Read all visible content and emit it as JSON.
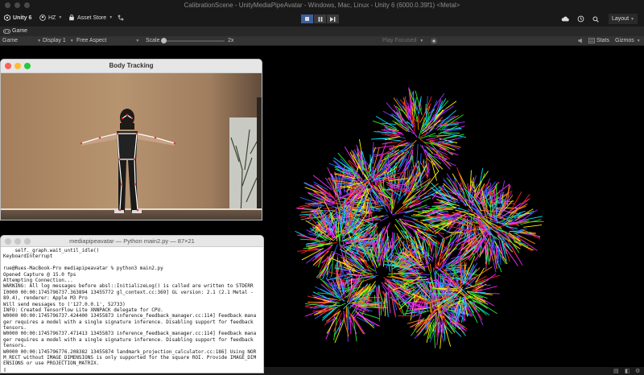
{
  "window": {
    "title": "CalibrationScene - UnityMediaPipeAvatar - Windows, Mac, Linux - Unity 6 (6000.0.39f1) <Metal>"
  },
  "toolbar": {
    "app_label": "Unity 6",
    "account_label": "HZ",
    "asset_store_label": "Asset Store",
    "layout_label": "Layout"
  },
  "tabs": {
    "game_label": "Game"
  },
  "game_controls": {
    "display_mode": "Game",
    "display": "Display 1",
    "aspect": "Free Aspect",
    "scale_label": "Scale",
    "scale_value": "2x",
    "play_focused": "Play Focused",
    "stats_label": "Stats",
    "gizmos_label": "Gizmos"
  },
  "body_tracking": {
    "title": "Body Tracking"
  },
  "terminal": {
    "title": "mediapipeavatar — Python main2.py — 87×21",
    "lines": [
      "    self._graph.wait_until_idle()",
      "KeyboardInterrupt",
      "",
      "rue@Rues-MacBook-Pro mediapipeavatar % python3 main2.py",
      "Opened Capture @ 15.0 fps",
      "Attempting Connection...",
      "WARNING: All log messages before absl::InitializeLog() is called are written to STDERR",
      "I0000 00:00:1745796737.363894 13455772 gl_context.cc:369] GL version: 2.1 (2.1 Metal -",
      "89.4), renderer: Apple M3 Pro",
      "Will send messages to ('127.0.0.1', 52733)",
      "INFO: Created TensorFlow Lite XNNPACK delegate for CPU.",
      "W0000 00:00:1745796737.424400 13455873 inference_feedback_manager.cc:114] Feedback mana",
      "ger requires a model with a single signature inference. Disabling support for feedback",
      "tensors.",
      "W0000 00:00:1745796737.471413 13455873 inference_feedback_manager.cc:114] Feedback mana",
      "ger requires a model with a single signature inference. Disabling support for feedback",
      "tensors.",
      "W0000 00:00:1745796776.208382 13455874 landmark_projection_calculator.cc:186] Using NOR",
      "M_RECT without IMAGE_DIMENSIONS is only supported for the square ROI. Provide IMAGE_DIM",
      "ENSIONS or use PROJECTION_MATRIX.",
      "▯"
    ]
  },
  "colors": {
    "editor_bg": "#191919",
    "play_active": "#3d5f99",
    "fur": [
      "#ff2020",
      "#22ee22",
      "#2266ff",
      "#ffee00",
      "#ff22ff",
      "#00e5ff",
      "#ff8800",
      "#9933ff"
    ]
  },
  "icons": {
    "unity": "unity-logo-icon",
    "account": "user-icon",
    "store": "bag-icon",
    "cloud": "cloud-icon",
    "history": "history-icon",
    "search": "search-icon",
    "layout": "chevron-down-icon"
  }
}
